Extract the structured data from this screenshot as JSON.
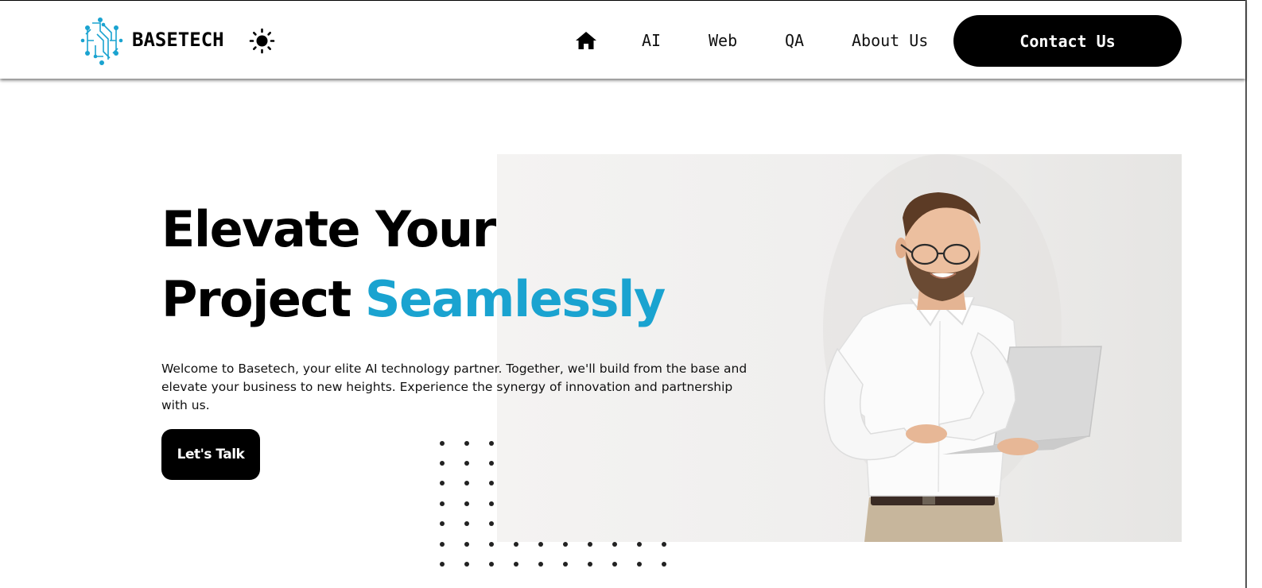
{
  "brand": {
    "name": "BASETECH",
    "logo_icon": "circuit-logo-icon",
    "accent_color": "#1aa3d0"
  },
  "header": {
    "theme_toggle_icon": "sun-icon",
    "home_icon": "home-icon",
    "nav": [
      {
        "label": "AI"
      },
      {
        "label": "Web"
      },
      {
        "label": "QA"
      },
      {
        "label": "About Us"
      }
    ],
    "contact_label": "Contact Us"
  },
  "hero": {
    "headline_line1": "Elevate Your",
    "headline_line2_plain": "Project",
    "headline_line2_accent": "Seamlessly",
    "intro": "Welcome to Basetech, your elite AI technology partner. Together, we'll build from the base and elevate your business to new heights. Experience the synergy of innovation and partnership with us.",
    "cta_label": "Let's Talk",
    "image": "smiling-man-with-laptop-photo"
  }
}
